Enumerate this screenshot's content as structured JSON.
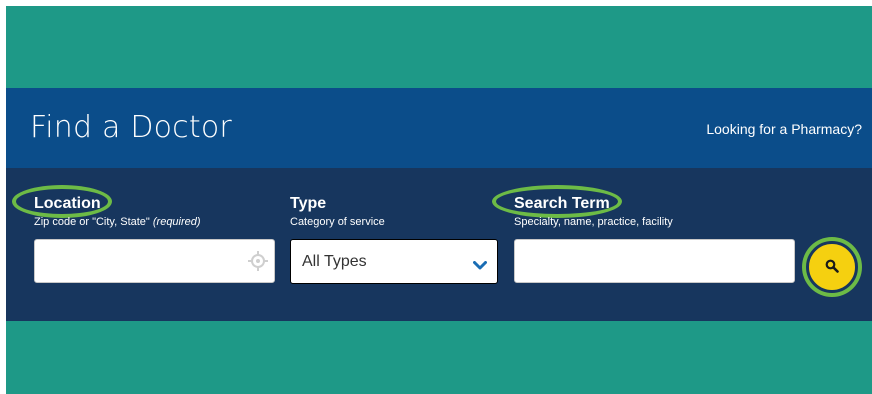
{
  "header": {
    "title": "Find a Doctor",
    "pharmacy_link": "Looking for a Pharmacy?"
  },
  "location": {
    "label": "Location",
    "hint_prefix": "Zip code or \"City, State\" ",
    "hint_required": "(required)",
    "value": "",
    "placeholder": ""
  },
  "type": {
    "label": "Type",
    "hint": "Category of service",
    "selected": "All Types"
  },
  "search_term": {
    "label": "Search Term",
    "hint": "Specialty, name, practice, facility",
    "value": "",
    "placeholder": ""
  },
  "icons": {
    "locate": "crosshair-icon",
    "dropdown": "chevron-down-icon",
    "search": "search-icon"
  },
  "colors": {
    "teal": "#1e9987",
    "header_blue": "#0b4d8a",
    "navy": "#17365e",
    "highlight_green": "#6dbb46",
    "search_yellow": "#f5d010",
    "chevron_blue": "#1a6db4"
  }
}
